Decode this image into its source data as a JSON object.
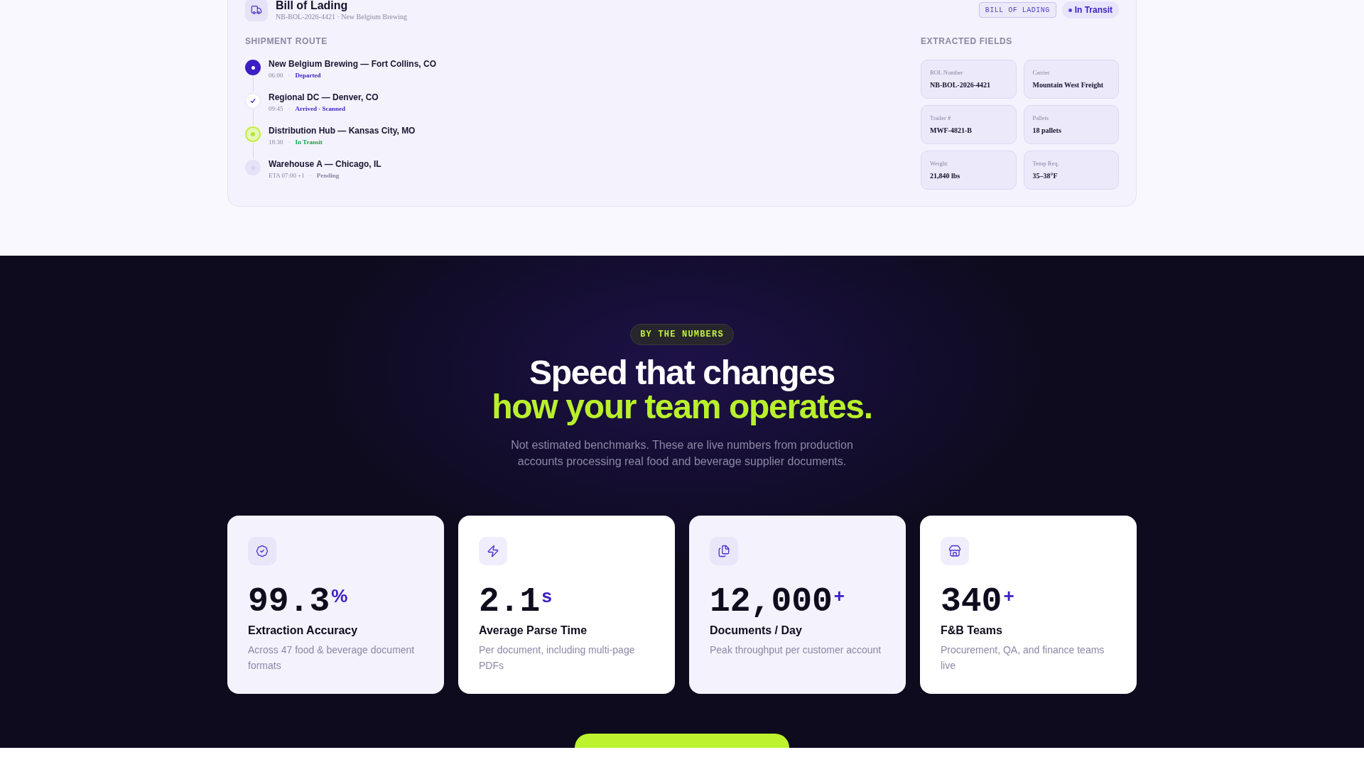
{
  "bol_card": {
    "title": "Bill of Lading",
    "subtitle": "NB-BOL-2026-4421 · New Belgium Brewing",
    "type_badge": "BILL OF LADING",
    "status_badge": "In Transit",
    "route": {
      "heading": "SHIPMENT ROUTE",
      "stops": [
        {
          "kind": "departed",
          "place": "New Belgium Brewing — Fort Collins, CO",
          "time": "06:00",
          "separator": "·",
          "status": "Departed"
        },
        {
          "kind": "arrived",
          "place": "Regional DC — Denver, CO",
          "time": "09:45",
          "separator": "·",
          "status": "Arrived · Scanned"
        },
        {
          "kind": "in_transit",
          "place": "Distribution Hub — Kansas City, MO",
          "time": "18:30",
          "separator": "·",
          "status": "In Transit"
        },
        {
          "kind": "pending",
          "place": "Warehouse A — Chicago, IL",
          "time": "ETA 07:00 +1",
          "separator": "·",
          "status": "Pending"
        }
      ]
    },
    "fields": {
      "heading": "EXTRACTED FIELDS",
      "items": [
        {
          "label": "BOL Number",
          "value": "NB-BOL-2026-4421"
        },
        {
          "label": "Carrier",
          "value": "Mountain West Freight"
        },
        {
          "label": "Trailer #",
          "value": "MWF-4821-B"
        },
        {
          "label": "Pallets",
          "value": "18 pallets"
        },
        {
          "label": "Weight",
          "value": "21,840 lbs"
        },
        {
          "label": "Temp Req.",
          "value": "35–38°F"
        }
      ]
    }
  },
  "numbers": {
    "badge": "BY THE NUMBERS",
    "headline": "Speed that changes",
    "headline_accent": "how your team operates.",
    "description": "Not estimated benchmarks. These are live numbers from production accounts processing real food and beverage supplier documents.",
    "stats": [
      {
        "kind": "accuracy",
        "value": "99.3",
        "suffix": "%",
        "label": "Extraction Accuracy",
        "description": "Across 47 food & beverage document formats"
      },
      {
        "kind": "speed",
        "value": "2.1",
        "suffix": "s",
        "label": "Average Parse Time",
        "description": "Per document, including multi-page PDFs"
      },
      {
        "kind": "volume",
        "value": "12,000",
        "suffix": "+",
        "label": "Documents / Day",
        "description": "Peak throughput per customer account"
      },
      {
        "kind": "teams",
        "value": "340",
        "suffix": "+",
        "label": "F&B Teams",
        "description": "Procurement, QA, and finance teams live"
      }
    ]
  }
}
